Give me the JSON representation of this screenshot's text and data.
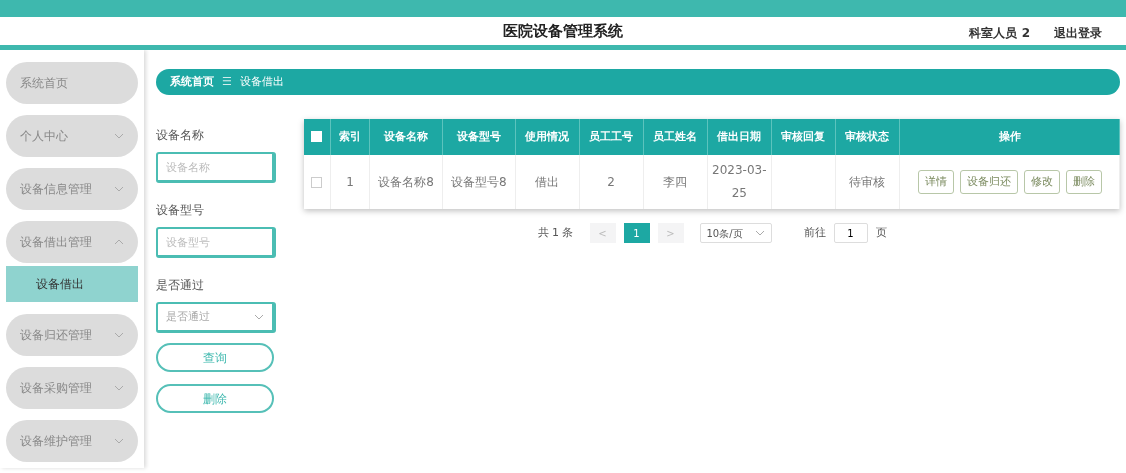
{
  "header": {
    "title": "医院设备管理系统",
    "user": "科室人员 2",
    "logout": "退出登录"
  },
  "sidebar": {
    "items": [
      {
        "kind": "link",
        "label": "系统首页"
      },
      {
        "kind": "menu",
        "label": "个人中心",
        "expanded": false
      },
      {
        "kind": "menu",
        "label": "设备信息管理",
        "expanded": false
      },
      {
        "kind": "menu",
        "label": "设备借出管理",
        "expanded": true,
        "children": [
          {
            "label": "设备借出",
            "selected": true
          }
        ]
      },
      {
        "kind": "menu",
        "label": "设备归还管理",
        "expanded": false
      },
      {
        "kind": "menu",
        "label": "设备采购管理",
        "expanded": false
      },
      {
        "kind": "menu",
        "label": "设备维护管理",
        "expanded": false
      }
    ]
  },
  "breadcrumb": {
    "home": "系统首页",
    "separator": "☰",
    "current": "设备借出"
  },
  "filters": [
    {
      "kind": "text",
      "label": "设备名称",
      "placeholder": "设备名称"
    },
    {
      "kind": "text",
      "label": "设备型号",
      "placeholder": "设备型号"
    },
    {
      "kind": "select",
      "label": "是否通过",
      "placeholder": "是否通过"
    }
  ],
  "filter_buttons": [
    "查询",
    "删除"
  ],
  "table": {
    "columns": [
      "索引",
      "设备名称",
      "设备型号",
      "使用情况",
      "员工工号",
      "员工姓名",
      "借出日期",
      "审核回复",
      "审核状态",
      "操作"
    ],
    "header_checked": false,
    "rows": [
      {
        "checked": false,
        "cells": [
          "1",
          "设备名称8",
          "设备型号8",
          "借出",
          "2",
          "李四",
          "2023-03-25",
          "",
          "待审核"
        ],
        "actions": [
          "详情",
          "设备归还",
          "修改",
          "删除"
        ]
      }
    ]
  },
  "pagination": {
    "total": "共 1 条",
    "prev": "<",
    "pages": [
      {
        "label": "1",
        "selected": true
      }
    ],
    "next": ">",
    "page_size": "10条/页",
    "goto_label": "前往",
    "goto_value": "1",
    "goto_suffix": "页"
  }
}
